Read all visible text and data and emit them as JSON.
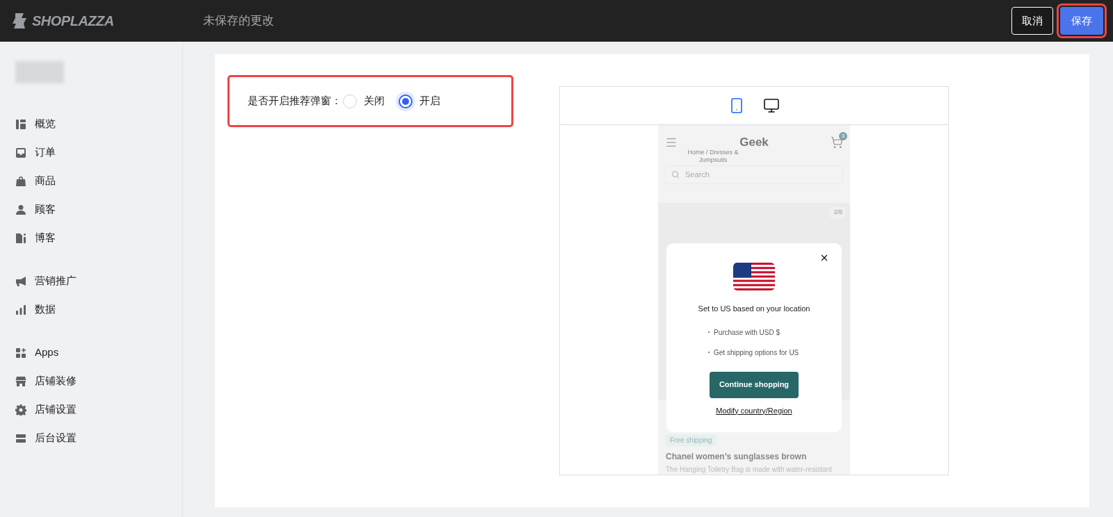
{
  "topbar": {
    "logo": "SHOPLAZZA",
    "title": "未保存的更改",
    "buttons": [
      {
        "label": "取消",
        "kind": "secondary",
        "highlighted": false
      },
      {
        "label": "保存",
        "kind": "primary",
        "highlighted": true
      }
    ]
  },
  "sidebar": {
    "groups": [
      {
        "items": [
          "概览",
          "订单",
          "商品",
          "顾客",
          "博客"
        ]
      },
      {
        "items": [
          "营销推广",
          "数据"
        ]
      },
      {
        "items": [
          "Apps",
          "店铺装修",
          "店铺设置",
          "后台设置"
        ]
      }
    ]
  },
  "setting": {
    "label": "是否开启推荐弹窗：",
    "highlighted": true,
    "options": [
      {
        "label": "关闭",
        "selected": false
      },
      {
        "label": "开启",
        "selected": true
      }
    ]
  },
  "preview": {
    "devices": [
      {
        "kind": "mobile",
        "selected": true
      },
      {
        "kind": "desktop",
        "selected": false
      }
    ],
    "store": {
      "name": "Geek",
      "cart_count": "3",
      "breadcrumb": "Home / Dresses & Jumpsuits",
      "search_placeholder": "Search",
      "slide_counter": "2/8",
      "tag": "Free shipping",
      "product_title": "Chanel women’s sunglasses brown",
      "product_description": "The Hanging Toiletry Bag is made with water-resistant"
    },
    "popup": {
      "message": "Set to US based on your location",
      "bullets": [
        "Purchase with USD $",
        "Get shipping options for US"
      ],
      "button": "Continue shopping",
      "link": "Modify country/Region"
    }
  }
}
